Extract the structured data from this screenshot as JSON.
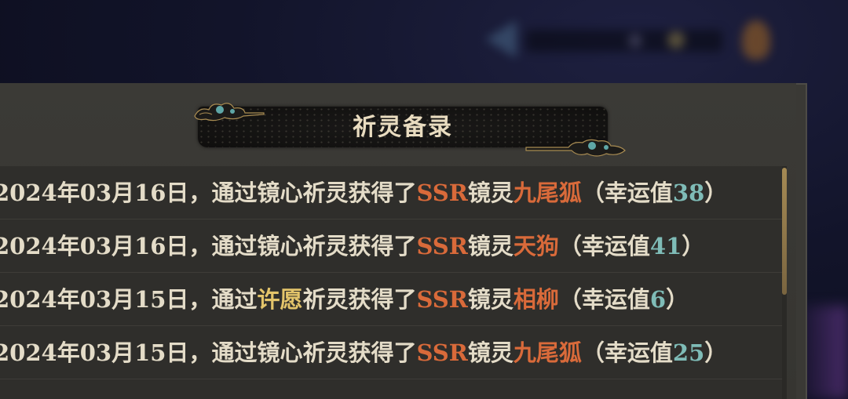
{
  "title": "祈灵备录",
  "colors": {
    "ssr_red": "#d96a3a",
    "wish_gold": "#e3c46a",
    "luck_teal": "#7fbcb7",
    "text_main": "#e4dcc8"
  },
  "records": [
    {
      "date": "2024年03月16日，",
      "prefix": "通过",
      "method": "镜心",
      "middle": "祈灵获得了",
      "rarity": "SSR",
      "type": "镜灵",
      "name": "九尾狐",
      "luck_open": "（幸运值",
      "luck_value": "38",
      "luck_close": "）"
    },
    {
      "date": "2024年03月16日，",
      "prefix": "通过",
      "method": "镜心",
      "middle": "祈灵获得了",
      "rarity": "SSR",
      "type": "镜灵",
      "name": "天狗",
      "luck_open": "（幸运值",
      "luck_value": "41",
      "luck_close": "）"
    },
    {
      "date": "2024年03月15日，",
      "prefix": "通过",
      "method": "许愿",
      "middle": "祈灵获得了",
      "rarity": "SSR",
      "type": "镜灵",
      "name": "相柳",
      "luck_open": "（幸运值",
      "luck_value": "6",
      "luck_close": "）"
    },
    {
      "date": "2024年03月15日，",
      "prefix": "通过",
      "method": "镜心",
      "middle": "祈灵获得了",
      "rarity": "SSR",
      "type": "镜灵",
      "name": "九尾狐",
      "luck_open": "（幸运值",
      "luck_value": "25",
      "luck_close": "）"
    }
  ]
}
